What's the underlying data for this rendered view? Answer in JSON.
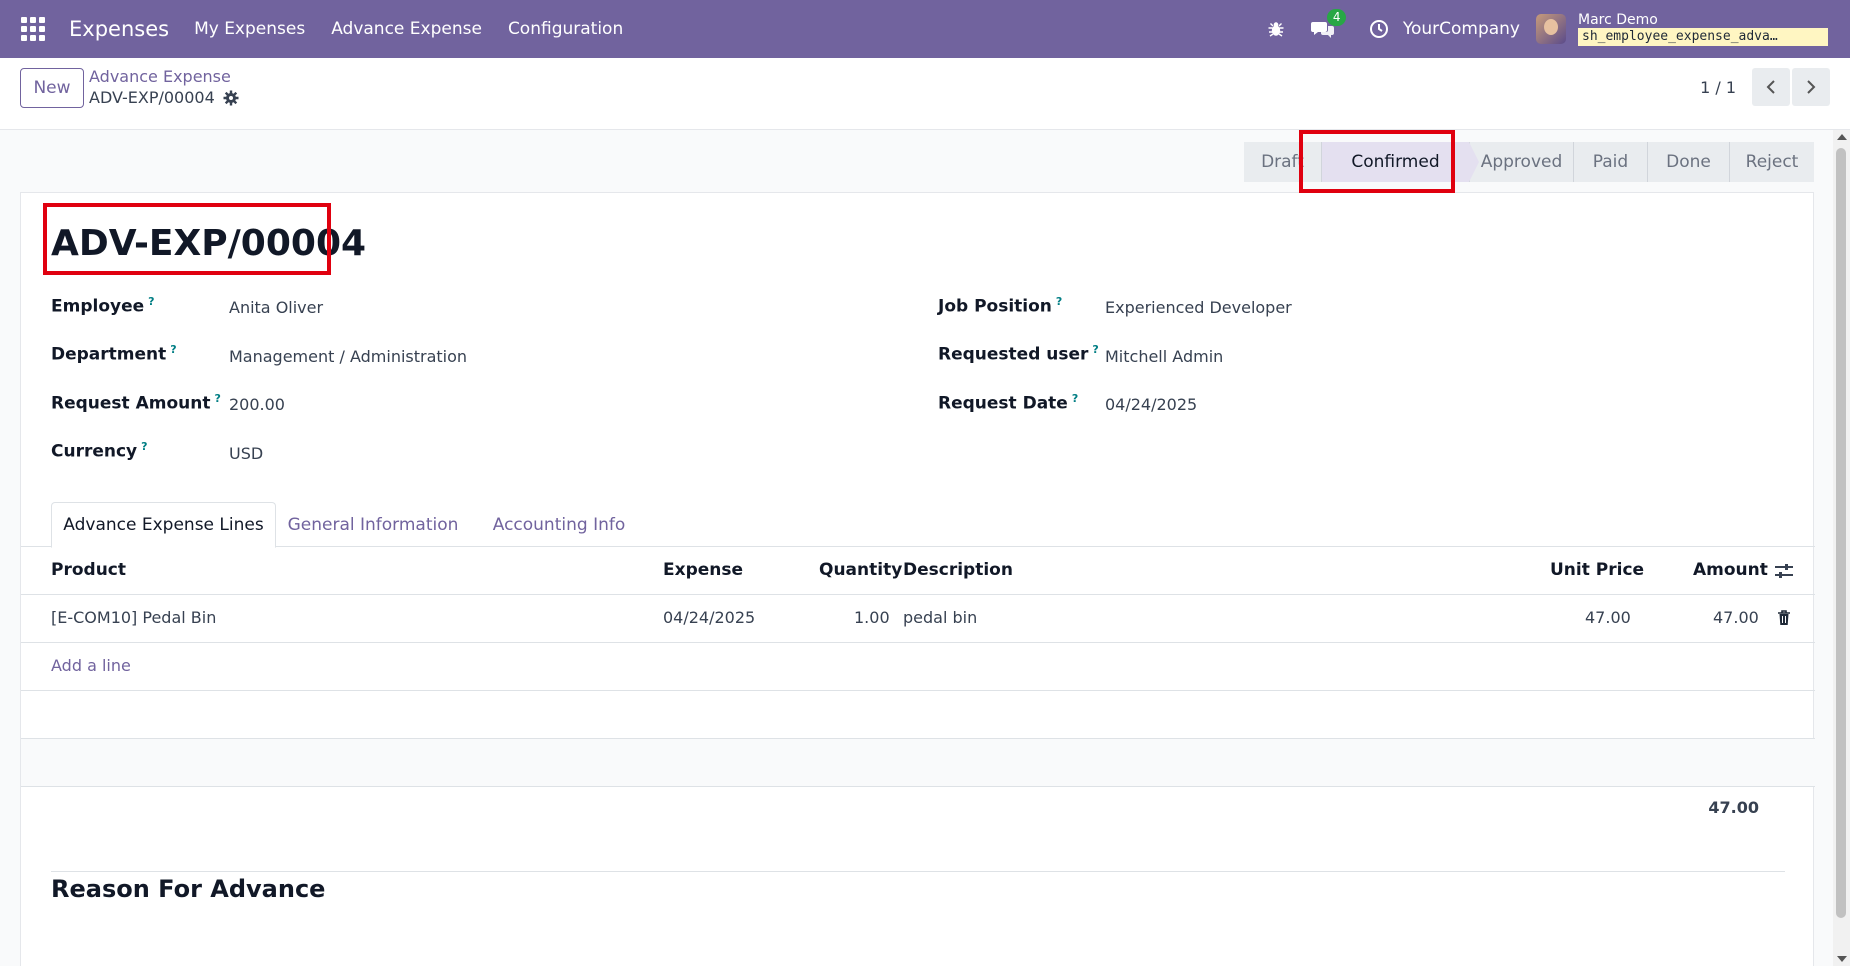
{
  "navbar": {
    "app_name": "Expenses",
    "menu": [
      "My Expenses",
      "Advance Expense",
      "Configuration"
    ],
    "message_count": "4",
    "company": "YourCompany",
    "user_name": "Marc Demo",
    "database": "sh_employee_expense_adva…"
  },
  "control_panel": {
    "new_label": "New",
    "breadcrumb_parent": "Advance Expense",
    "breadcrumb_current": "ADV-EXP/00004",
    "pager_value": "1 / 1"
  },
  "statusbar": {
    "stages": [
      "Draft",
      "Confirmed",
      "Approved",
      "Paid",
      "Done",
      "Reject"
    ],
    "current": "Confirmed"
  },
  "form": {
    "title": "ADV-EXP/00004",
    "left_fields": [
      {
        "label": "Employee",
        "value": "Anita Oliver"
      },
      {
        "label": "Department",
        "value": "Management / Administration"
      },
      {
        "label": "Request Amount",
        "value": "200.00"
      },
      {
        "label": "Currency",
        "value": "USD"
      }
    ],
    "right_fields": [
      {
        "label": "Job Position",
        "value": "Experienced Developer"
      },
      {
        "label": "Requested user",
        "value": "Mitchell Admin"
      },
      {
        "label": "Request Date",
        "value": "04/24/2025"
      }
    ],
    "help_marker": "?"
  },
  "tabs": [
    "Advance Expense Lines",
    "General Information",
    "Accounting Info"
  ],
  "lines_table": {
    "columns": [
      "Product",
      "Expense",
      "Quantity",
      "Description",
      "Unit Price",
      "Amount"
    ],
    "rows": [
      {
        "product": "[E-COM10] Pedal Bin",
        "expense": "04/24/2025",
        "quantity": "1.00",
        "description": "pedal bin",
        "unit_price": "47.00",
        "amount": "47.00"
      }
    ],
    "add_line_label": "Add a line",
    "total": "47.00"
  },
  "reason_section": {
    "title": "Reason For Advance"
  },
  "colors": {
    "brand": "#71639e",
    "highlight": "#e0000f",
    "badge": "#28a745"
  }
}
